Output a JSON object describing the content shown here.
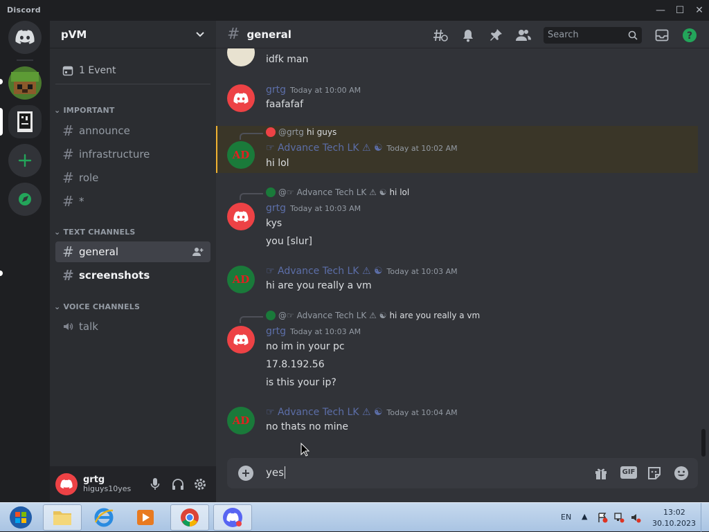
{
  "window": {
    "app_name": "Discord",
    "minimize": "—",
    "maximize": "☐",
    "close": "✕"
  },
  "guild_rail": [
    {
      "name": "discord-home-icon",
      "color": "#313338"
    },
    {
      "name": "server-minecraft-icon",
      "color": "#4a7a2e"
    },
    {
      "name": "server-pvm-icon",
      "color": "#313338"
    },
    {
      "name": "add-server-icon",
      "color": "#313338"
    },
    {
      "name": "explore-icon",
      "color": "#313338"
    }
  ],
  "server": {
    "name": "pVM",
    "chevron": "⌄"
  },
  "events": {
    "label": "1 Event"
  },
  "categories": {
    "important": "IMPORTANT",
    "text": "TEXT CHANNELS",
    "voice": "VOICE CHANNELS"
  },
  "channels": {
    "important": [
      {
        "name": "announce"
      },
      {
        "name": "infrastructure"
      },
      {
        "name": "role"
      },
      {
        "name": "*"
      }
    ],
    "text": [
      {
        "name": "general",
        "active": true
      },
      {
        "name": "screenshots",
        "unread": true
      }
    ],
    "voice": [
      {
        "name": "talk"
      }
    ]
  },
  "user": {
    "name": "grtg",
    "status": "higuys10yes"
  },
  "channel_header": {
    "name": "general",
    "search_placeholder": "Search"
  },
  "messages": [
    {
      "id": "m0",
      "text": "idfk man"
    },
    {
      "id": "m1",
      "author": "grtg",
      "time": "Today at 10:00 AM",
      "lines": [
        "faafafaf"
      ]
    },
    {
      "id": "m2",
      "reply_to": "@grtg",
      "reply_text": "hi guys",
      "author": "☞ Advance Tech LK ⚠ ☯",
      "time": "Today at 10:02 AM",
      "lines": [
        "hi lol"
      ],
      "highlight": true
    },
    {
      "id": "m3",
      "reply_to": "@☞ Advance Tech LK ⚠ ☯",
      "reply_text": "hi lol",
      "author": "grtg",
      "time": "Today at 10:03 AM",
      "lines": [
        "kys",
        "you [slur]"
      ]
    },
    {
      "id": "m4",
      "author": "☞ Advance Tech LK ⚠ ☯",
      "time": "Today at 10:03 AM",
      "lines": [
        "hi are you really a vm"
      ]
    },
    {
      "id": "m5",
      "reply_to": "@☞ Advance Tech LK ⚠ ☯",
      "reply_text": "hi are you really a vm",
      "author": "grtg",
      "time": "Today at 10:03 AM",
      "lines": [
        "no im in your pc",
        "17.8.192.56",
        "is this your ip?"
      ]
    },
    {
      "id": "m6",
      "author": "☞ Advance Tech LK ⚠ ☯",
      "time": "Today at 10:04 AM",
      "lines": [
        "no thats no mine"
      ]
    }
  ],
  "composer": {
    "value": "yes",
    "gif_label": "GIF"
  },
  "taskbar": {
    "apps": [
      "start-button",
      "file-explorer",
      "internet-explorer",
      "media-player",
      "chrome",
      "discord"
    ],
    "language": "EN",
    "time": "13:02",
    "date": "30.10.2023"
  },
  "colors": {
    "discord_red": "#ed4245",
    "online_green": "#23a55a",
    "mention_highlight": "#3a3628",
    "mention_bar": "#f0b232"
  }
}
